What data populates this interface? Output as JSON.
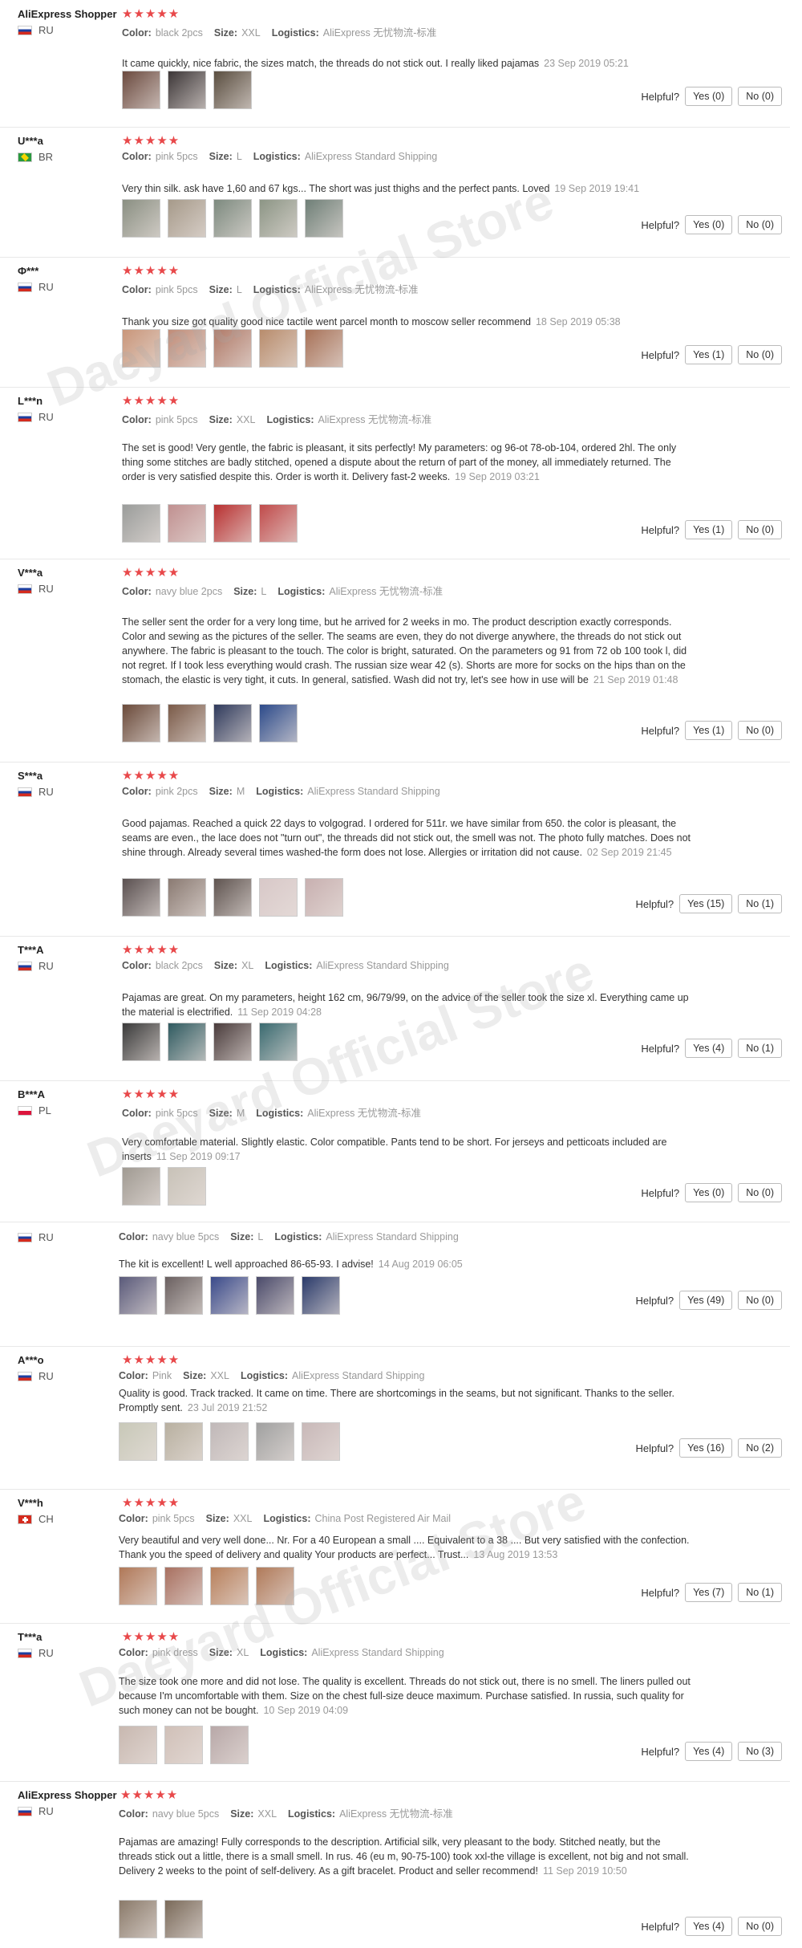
{
  "labels": {
    "color": "Color:",
    "size": "Size:",
    "logistics": "Logistics:",
    "helpful": "Helpful?"
  },
  "watermark": "Daeyard Official Store",
  "colors": {
    "stars": "#e8484a",
    "meta_text": "#999999",
    "border": "#e8e8e8"
  },
  "reviews": [
    {
      "user": "AliExpress Shopper",
      "country": "RU",
      "flag": "ru",
      "stars": 5,
      "color": "black 2pcs",
      "size": "XXL",
      "logistics": "AliExpress 无忧物流-标准",
      "text": "It came quickly, nice fabric, the sizes match, the threads do not stick out. I really liked pajamas",
      "date": "23 Sep 2019 05:21",
      "photos": [
        "#6b4a3f",
        "#3c3637",
        "#5a4e40"
      ],
      "yes": "Yes (0)",
      "no": "No (0)"
    },
    {
      "user": "U***a",
      "country": "BR",
      "flag": "br",
      "stars": 5,
      "color": "pink 5pcs",
      "size": "L",
      "logistics": "AliExpress Standard Shipping",
      "text": "Very thin silk. ask have 1,60 and 67 kgs... The short was just thighs and the perfect pants. Loved",
      "date": "19 Sep 2019 19:41",
      "photos": [
        "#8a8f82",
        "#a69a8a",
        "#7d8a7f",
        "#8c9585",
        "#6f7f77"
      ],
      "yes": "Yes (0)",
      "no": "No (0)"
    },
    {
      "user": "Ф***",
      "country": "RU",
      "flag": "ru",
      "stars": 5,
      "color": "pink 5pcs",
      "size": "L",
      "logistics": "AliExpress 无忧物流-标准",
      "text": "Thank you size got quality good nice tactile went parcel month to moscow seller recommend",
      "date": "18 Sep 2019 05:38",
      "photos": [
        "#c9967a",
        "#c08c78",
        "#b07a68",
        "#b88c6c",
        "#a87258"
      ],
      "yes": "Yes (1)",
      "no": "No (0)"
    },
    {
      "user": "L***n",
      "country": "RU",
      "flag": "ru",
      "stars": 5,
      "color": "pink 5pcs",
      "size": "XXL",
      "logistics": "AliExpress 无忧物流-标准",
      "text": "The set is good! Very gentle, the fabric is pleasant, it sits perfectly! My parameters: og 96-ot 78-ob-104, ordered 2hl. The only thing some stitches are badly stitched, opened a dispute about the return of part of the money, all immediately returned. The order is very satisfied despite this. Order is worth it. Delivery fast-2 weeks.",
      "date": "19 Sep 2019 03:21",
      "photos": [
        "#9a9c9a",
        "#c09090",
        "#b83030",
        "#c04a4a"
      ],
      "yes": "Yes (1)",
      "no": "No (0)"
    },
    {
      "user": "V***a",
      "country": "RU",
      "flag": "ru",
      "stars": 5,
      "color": "navy blue 2pcs",
      "size": "L",
      "logistics": "AliExpress 无忧物流-标准",
      "text": "The seller sent the order for a very long time, but he arrived for 2 weeks in mo. The product description exactly corresponds. Color and sewing as the pictures of the seller. The seams are even, they do not diverge anywhere, the threads do not stick out anywhere. The fabric is pleasant to the touch. The color is bright, saturated. On the parameters og 91 from 72 ob 100 took l, did not regret. If I took less everything would crash. The russian size wear 42 (s). Shorts are more for socks on the hips than on the stomach, the elastic is very tight, it cuts. In general, satisfied. Wash did not try, let's see how in use will be",
      "date": "21 Sep 2019 01:48",
      "photos": [
        "#6a4a3a",
        "#7a5a48",
        "#2f3a5c",
        "#2c4a8a"
      ],
      "yes": "Yes (1)",
      "no": "No (0)"
    },
    {
      "user": "S***a",
      "country": "RU",
      "flag": "ru",
      "stars": 5,
      "color": "pink 2pcs",
      "size": "M",
      "logistics": "AliExpress Standard Shipping",
      "text": "Good pajamas. Reached a quick 22 days to volgograd. I ordered for 511r. we have similar from 650. the color is pleasant, the seams are even., the lace does not \"turn out\", the threads did not stick out, the smell was not. The photo fully matches. Does not shine through. Already several times washed-the form does not lose. Allergies or irritation did not cause.",
      "date": "02 Sep 2019 21:45",
      "photos": [
        "#5a5050",
        "#8a7a72",
        "#5f5450",
        "#d8c8c8",
        "#c8b0b0"
      ],
      "yes": "Yes (15)",
      "no": "No (1)"
    },
    {
      "user": "T***A",
      "country": "RU",
      "flag": "ru",
      "stars": 5,
      "color": "black 2pcs",
      "size": "XL",
      "logistics": "AliExpress Standard Shipping",
      "text": "Pajamas are great. On my parameters, height 162 cm, 96/79/99, on the advice of the seller took the size xl. Everything came up the material is electrified.",
      "date": "11 Sep 2019 04:28",
      "photos": [
        "#3a3a3a",
        "#2f5a60",
        "#4a3c3c",
        "#3a6a70"
      ],
      "yes": "Yes (4)",
      "no": "No (1)"
    },
    {
      "user": "B***A",
      "country": "PL",
      "flag": "pl",
      "stars": 5,
      "color": "pink 5pcs",
      "size": "M",
      "logistics": "AliExpress 无忧物流-标准",
      "text": "Very comfortable material. Slightly elastic. Color compatible. Pants tend to be short. For jerseys and petticoats included are inserts",
      "date": "11 Sep 2019 09:17",
      "photos": [
        "#a09a92",
        "#c8c2b8"
      ],
      "yes": "Yes (0)",
      "no": "No (0)"
    },
    {
      "user": "",
      "country": "RU",
      "flag": "ru",
      "stars": 0,
      "color": "navy blue 5pcs",
      "size": "L",
      "logistics": "AliExpress Standard Shipping",
      "text": "The kit is excellent! L well approached 86-65-93. I advise!",
      "date": "14 Aug 2019 06:05",
      "photos": [
        "#5a5a7a",
        "#6a6060",
        "#3a4a8a",
        "#4a4a6a",
        "#2a3a6a"
      ],
      "yes": "Yes (49)",
      "no": "No (0)"
    },
    {
      "user": "A***o",
      "country": "RU",
      "flag": "ru",
      "stars": 5,
      "color": "Pink",
      "size": "XXL",
      "logistics": "AliExpress Standard Shipping",
      "text": "Quality is good. Track tracked. It came on time. There are shortcomings in the seams, but not significant. Thanks to the seller. Promptly sent.",
      "date": "23 Jul 2019 21:52",
      "photos": [
        "#c8c8b8",
        "#b8b0a0",
        "#c0b8b8",
        "#a0a0a0",
        "#c8b8b8"
      ],
      "yes": "Yes (16)",
      "no": "No (2)"
    },
    {
      "user": "V***h",
      "country": "CH",
      "flag": "ch",
      "stars": 5,
      "color": "pink 5pcs",
      "size": "XXL",
      "logistics": "China Post Registered Air Mail",
      "text": "Very beautiful and very well done... Nr. For a 40 European a small .... Equivalent to a 38 .... But very satisfied with the confection. Thank you the speed of delivery and quality Your products are perfect... Trust...",
      "date": "13 Aug 2019 13:53",
      "photos": [
        "#b07858",
        "#a87060",
        "#b8805c",
        "#b07a5a"
      ],
      "yes": "Yes (7)",
      "no": "No (1)"
    },
    {
      "user": "T***a",
      "country": "RU",
      "flag": "ru",
      "stars": 5,
      "color": "pink dress",
      "size": "XL",
      "logistics": "AliExpress Standard Shipping",
      "text": "The size took one more and did not lose. The quality is excellent. Threads do not stick out, there is no smell. The liners pulled out because I'm uncomfortable with them. Size on the chest full-size deuce maximum. Purchase satisfied. In russia, such quality for such money can not be bought.",
      "date": "10 Sep 2019 04:09",
      "photos": [
        "#c8b8b0",
        "#d0c0b8",
        "#b8a8a8"
      ],
      "yes": "Yes (4)",
      "no": "No (3)"
    },
    {
      "user": "AliExpress Shopper",
      "country": "RU",
      "flag": "ru",
      "stars": 5,
      "color": "navy blue 5pcs",
      "size": "XXL",
      "logistics": "AliExpress 无忧物流-标准",
      "text": "Pajamas are amazing! Fully corresponds to the description. Artificial silk, very pleasant to the body. Stitched neatly, but the threads stick out a little, there is a small smell. In rus. 46 (eu m, 90-75-100) took xxl-the village is excellent, not big and not small. Delivery 2 weeks to the point of self-delivery. As a gift bracelet. Product and seller recommend!",
      "date": "11 Sep 2019 10:50",
      "photos": [
        "#8a7a6a",
        "#7a6a5a"
      ],
      "yes": "Yes (4)",
      "no": "No (0)"
    }
  ]
}
